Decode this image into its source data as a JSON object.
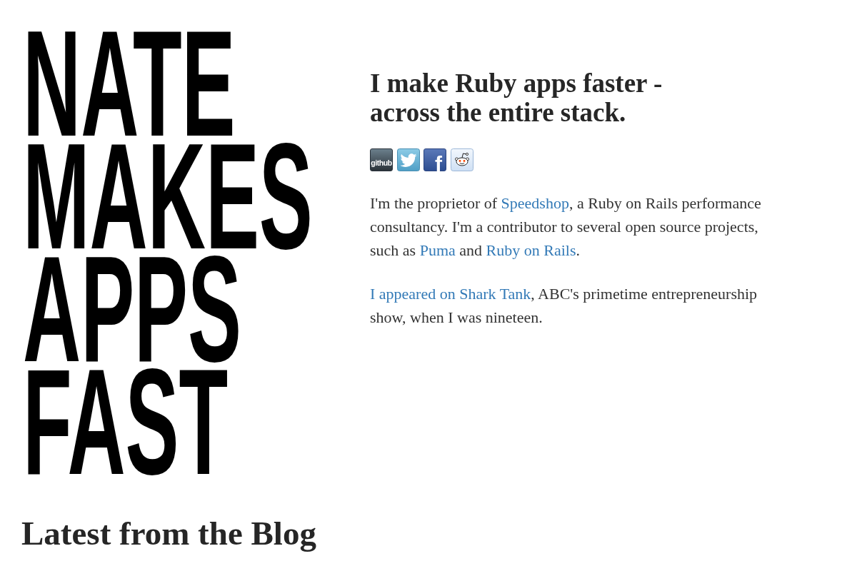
{
  "title": "NATE MAKES APPS FAST",
  "tagline": "I make Ruby apps faster - across the entire stack.",
  "social_links": [
    {
      "kind": "github",
      "label": "github"
    },
    {
      "kind": "twitter"
    },
    {
      "kind": "facebook",
      "label": "f"
    },
    {
      "kind": "reddit"
    }
  ],
  "paragraphs": [
    [
      {
        "kind": "text",
        "text": "I'm the proprietor of "
      },
      {
        "kind": "link",
        "text": "Speedshop"
      },
      {
        "kind": "text",
        "text": ", a Ruby on Rails performance consultancy. I'm a contributor to several open source projects, such as "
      },
      {
        "kind": "link",
        "text": "Puma"
      },
      {
        "kind": "text",
        "text": " and "
      },
      {
        "kind": "link",
        "text": "Ruby on Rails"
      },
      {
        "kind": "text",
        "text": "."
      }
    ],
    [
      {
        "kind": "link",
        "text": "I appeared on Shark Tank"
      },
      {
        "kind": "text",
        "text": ", ABC's primetime entrepreneurship show, when I was nineteen."
      }
    ]
  ],
  "blog_heading": "Latest from the Blog"
}
